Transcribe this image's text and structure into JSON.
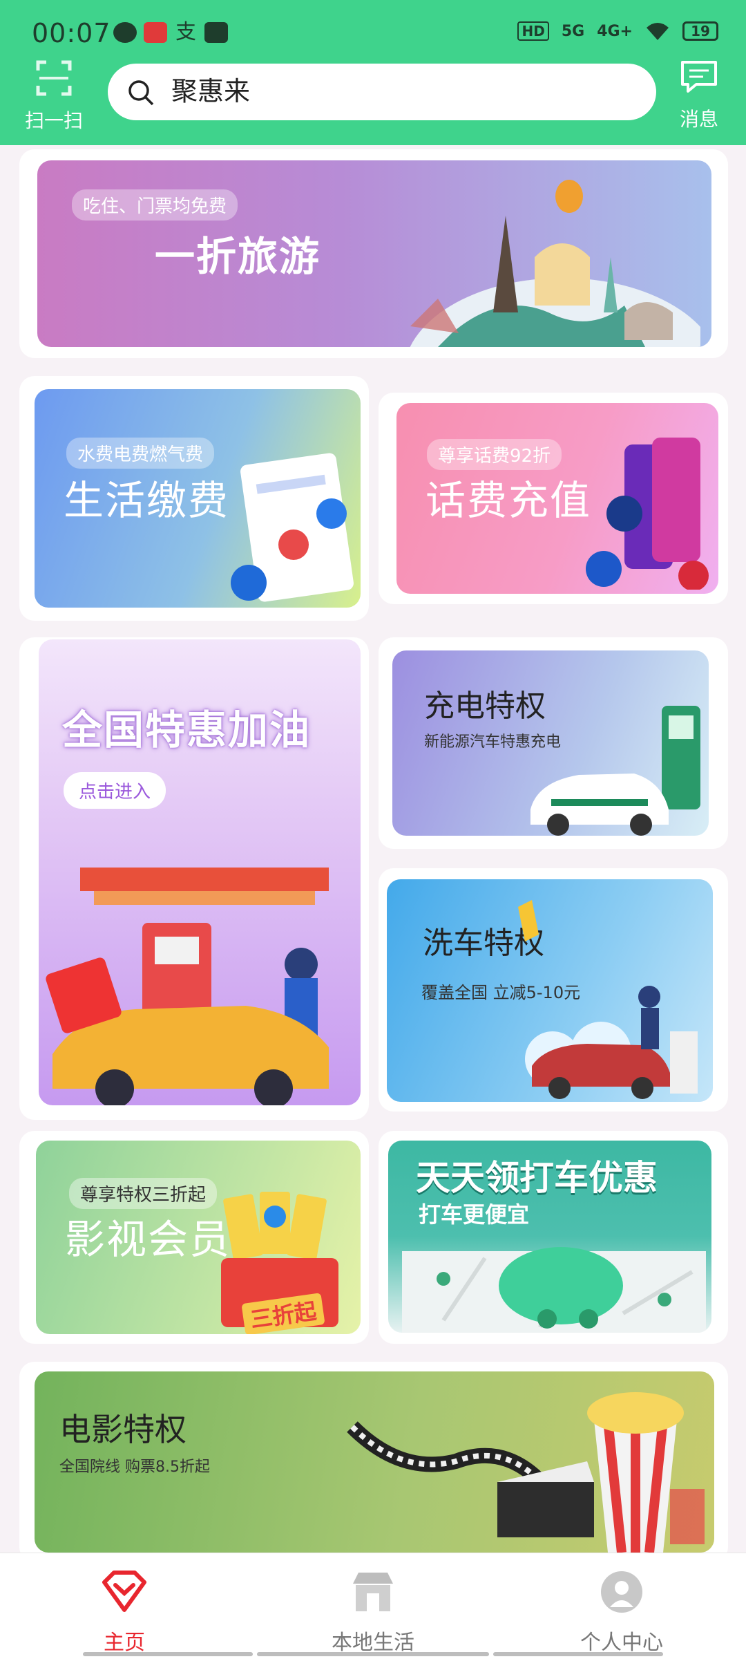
{
  "status_bar": {
    "time": "00:07",
    "hd_label": "HD",
    "net_5g": "5G",
    "net_4g": "4G+",
    "battery": "19"
  },
  "header": {
    "scan_label": "扫一扫",
    "search_text": "聚惠来",
    "messages_label": "消息"
  },
  "banners": {
    "travel": {
      "tag": "吃住、门票均免费",
      "title": "一折旅游"
    },
    "utilities": {
      "tag": "水费电费燃气费",
      "title": "生活缴费"
    },
    "phone": {
      "tag": "尊享话费92折",
      "title": "话费充值"
    },
    "fuel": {
      "title": "全国特惠加油",
      "button": "点击进入"
    },
    "charging": {
      "title": "充电特权",
      "subtitle": "新能源汽车特惠充电"
    },
    "carwash": {
      "title": "洗车特权",
      "subtitle": "覆盖全国 立减5-10元"
    },
    "video": {
      "tag": "尊享特权三折起",
      "title": "影视会员",
      "badge": "三折起"
    },
    "taxi": {
      "title": "天天领打车优惠",
      "subtitle": "打车更便宜"
    },
    "movie": {
      "title": "电影特权",
      "subtitle": "全国院线 购票8.5折起"
    }
  },
  "bottom_nav": {
    "items": [
      {
        "label": "主页",
        "active": true
      },
      {
        "label": "本地生活",
        "active": false
      },
      {
        "label": "个人中心",
        "active": false
      }
    ]
  },
  "colors": {
    "header_green": "#3fd38c",
    "active_red": "#e8262e"
  }
}
